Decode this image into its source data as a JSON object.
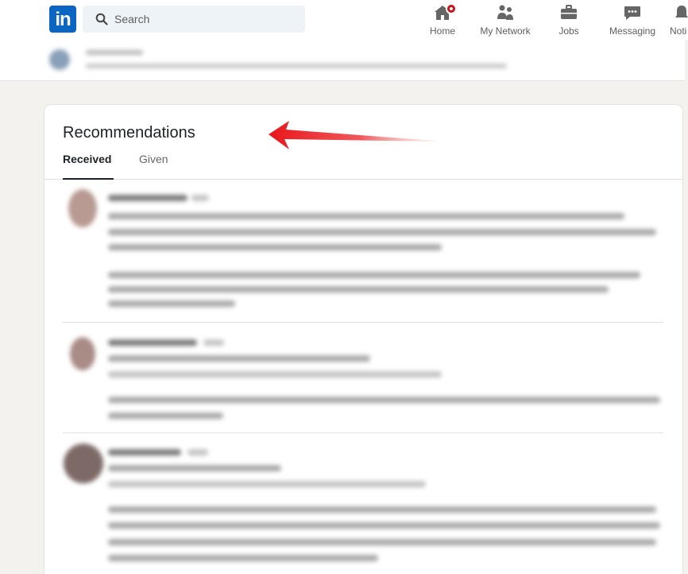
{
  "nav": {
    "logo_text": "in",
    "search_placeholder": "Search",
    "items": [
      {
        "label": "Home",
        "icon": "home-icon"
      },
      {
        "label": "My Network",
        "icon": "network-icon"
      },
      {
        "label": "Jobs",
        "icon": "briefcase-icon"
      },
      {
        "label": "Messaging",
        "icon": "messaging-icon"
      },
      {
        "label": "Noti",
        "icon": "bell-icon"
      }
    ]
  },
  "card": {
    "title": "Recommendations",
    "tabs": [
      {
        "label": "Received",
        "active": true
      },
      {
        "label": "Given",
        "active": false
      }
    ]
  },
  "colors": {
    "brand": "#0a66c2",
    "notification": "#cc1016",
    "arrow": "#e8151b"
  }
}
